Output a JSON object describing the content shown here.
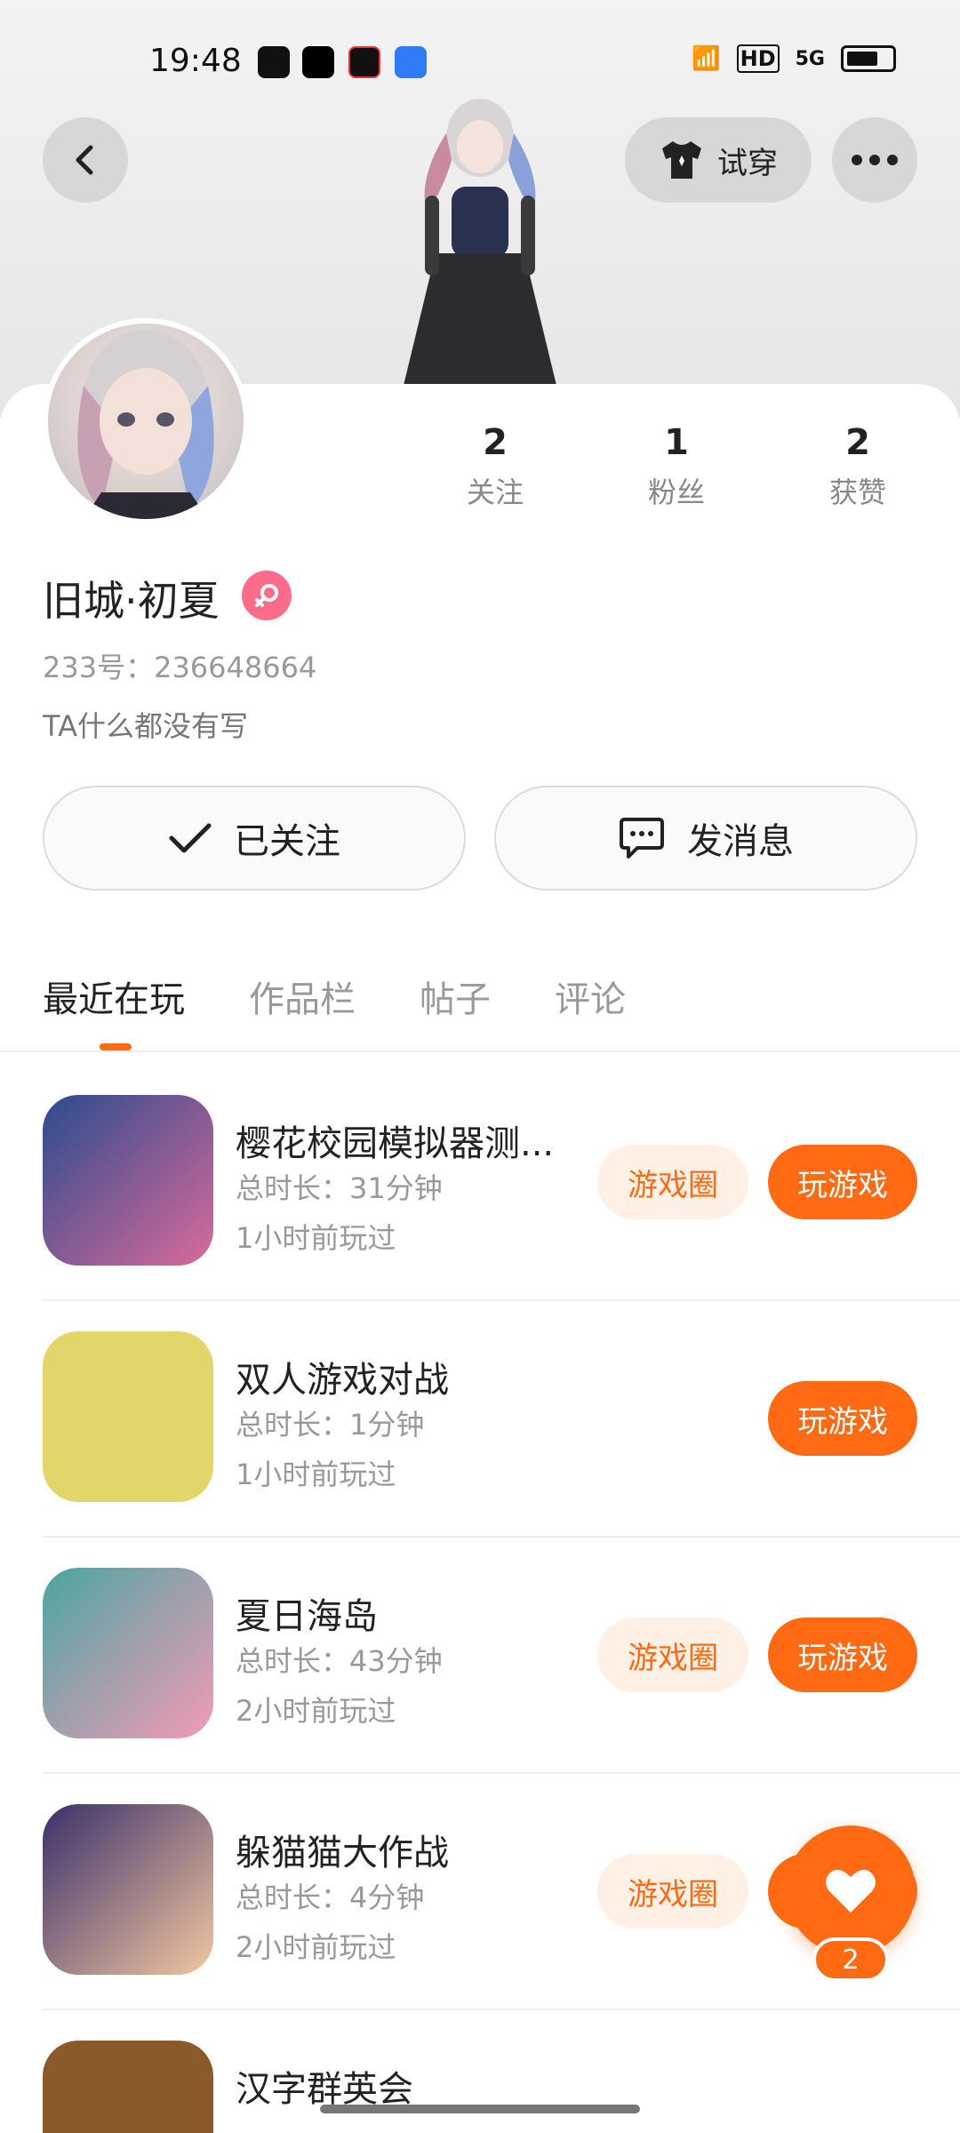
{
  "status_bar": {
    "time": "19:48",
    "network": "HD",
    "signal": "5G"
  },
  "header": {
    "try_on_label": "试穿",
    "icons": [
      "back-icon",
      "shirt-icon",
      "more-icon"
    ]
  },
  "profile": {
    "name": "旧城·初夏",
    "uid": "233号：236648664",
    "bio": "TA什么都没有写",
    "stats": [
      {
        "value": "2",
        "label": "关注"
      },
      {
        "value": "1",
        "label": "粉丝"
      },
      {
        "value": "2",
        "label": "获赞"
      }
    ],
    "followed_label": "已关注",
    "message_label": "发消息"
  },
  "tabs": [
    "最近在玩",
    "作品栏",
    "帖子",
    "评论"
  ],
  "games": [
    {
      "title": "樱花校园模拟器测...",
      "duration": "总时长：31分钟",
      "last_played": "1小时前玩过",
      "has_circle": true
    },
    {
      "title": "双人游戏对战",
      "duration": "总时长：1分钟",
      "last_played": "1小时前玩过",
      "has_circle": false
    },
    {
      "title": "夏日海岛",
      "duration": "总时长：43分钟",
      "last_played": "2小时前玩过",
      "has_circle": true
    },
    {
      "title": "躲猫猫大作战",
      "duration": "总时长：4分钟",
      "last_played": "2小时前玩过",
      "has_circle": true
    },
    {
      "title": "汉字群英会",
      "duration": "",
      "last_played": "",
      "has_circle": false
    }
  ],
  "buttons": {
    "circle_label": "游戏圈",
    "play_label": "玩游戏"
  },
  "like": {
    "count": "2"
  },
  "colors": {
    "accent": "#ff6a13",
    "accent_light": "#fff0e6",
    "gender": "#ff6b8b"
  }
}
